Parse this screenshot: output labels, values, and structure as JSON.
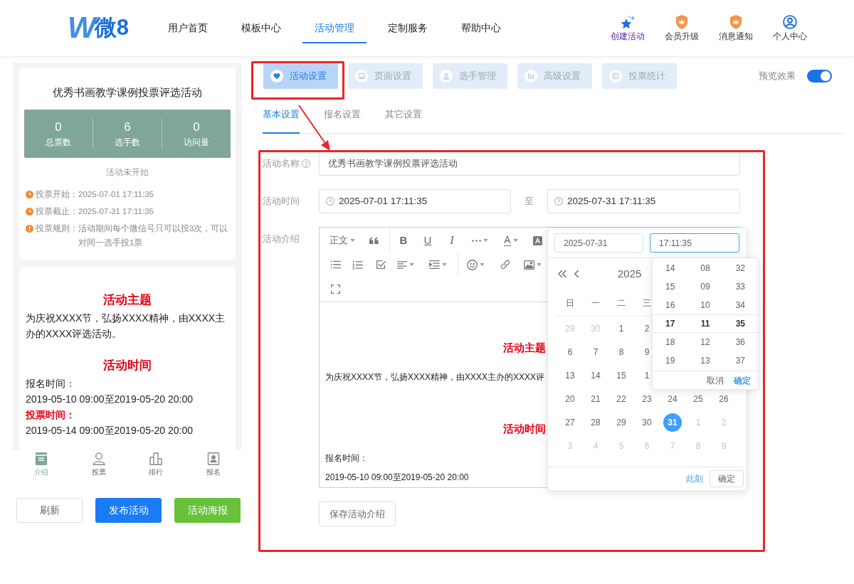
{
  "header": {
    "logo": {
      "mark": "W",
      "name": "微8"
    },
    "nav": [
      {
        "label": "用户首页",
        "selected": false
      },
      {
        "label": "模板中心",
        "selected": false
      },
      {
        "label": "活动管理",
        "selected": true
      },
      {
        "label": "定制服务",
        "selected": false
      },
      {
        "label": "帮助中心",
        "selected": false
      }
    ],
    "actions": [
      {
        "label": "创建活动",
        "highlighted": true
      },
      {
        "label": "会员升级",
        "highlighted": false
      },
      {
        "label": "消息通知",
        "highlighted": false
      },
      {
        "label": "个人中心",
        "highlighted": false
      }
    ]
  },
  "preview": {
    "title": "优秀书画教学课例投票评选活动",
    "stats": [
      {
        "value": "0",
        "label": "总票数"
      },
      {
        "value": "6",
        "label": "选手数"
      },
      {
        "value": "0",
        "label": "访问量"
      }
    ],
    "status": "活动未开始",
    "info": [
      {
        "kind": "time",
        "label": "投票开始：",
        "value": "2025-07-01 17:11:35"
      },
      {
        "kind": "time",
        "label": "投票截止：",
        "value": "2025-07-31 17:11:35"
      },
      {
        "kind": "rule",
        "label": "投票规则：",
        "value": "活动期间每个微信号只可以投3次，可以对同一选手投1票"
      }
    ],
    "article": [
      {
        "kind": "heading",
        "text": "活动主题"
      },
      {
        "kind": "paragraph",
        "text": "为庆祝XXXX节，弘扬XXXX精神，由XXXX主办的XXXX评选活动。"
      },
      {
        "kind": "heading",
        "text": "活动时间"
      },
      {
        "kind": "paragraph",
        "text": "报名时间："
      },
      {
        "kind": "paragraph",
        "text": "2019-05-10 09:00至2019-05-20 20:00"
      },
      {
        "kind": "label",
        "text": "投票时间："
      },
      {
        "kind": "paragraph",
        "text": "2019-05-14 09:00至2019-05-20 20:00"
      }
    ],
    "tabbar": [
      {
        "label": "介绍",
        "selected": true
      },
      {
        "label": "投票",
        "selected": false
      },
      {
        "label": "排行",
        "selected": false
      },
      {
        "label": "报名",
        "selected": false
      }
    ]
  },
  "preview_buttons": [
    {
      "label": "刷新",
      "kind": "default"
    },
    {
      "label": "发布活动",
      "kind": "primary"
    },
    {
      "label": "活动海报",
      "kind": "success"
    }
  ],
  "settings_tabs": [
    {
      "label": "活动设置",
      "selected": true
    },
    {
      "label": "页面设置",
      "selected": false
    },
    {
      "label": "选手管理",
      "selected": false
    },
    {
      "label": "高级设置",
      "selected": false
    },
    {
      "label": "投票统计",
      "selected": false
    }
  ],
  "preview_toggle": {
    "label": "预览效果",
    "on": true
  },
  "sub_tabs": [
    {
      "label": "基本设置",
      "selected": true
    },
    {
      "label": "报名设置",
      "selected": false
    },
    {
      "label": "其它设置",
      "selected": false
    }
  ],
  "form": {
    "name": {
      "label": "活动名称",
      "value": "优秀书画教学课例投票评选活动"
    },
    "time": {
      "label": "活动时间",
      "start": "2025-07-01 17:11:35",
      "separator": "至",
      "end": "2025-07-31 17:11:35"
    },
    "intro": {
      "label": "活动介绍",
      "toolbar": [
        [
          {
            "kind": "format",
            "text": "正文"
          },
          {
            "kind": "quote"
          },
          {
            "kind": "divider"
          },
          {
            "kind": "bold",
            "text": "B"
          },
          {
            "kind": "underline",
            "text": "U"
          },
          {
            "kind": "italic",
            "text": "I"
          },
          {
            "kind": "more"
          },
          {
            "kind": "font_color",
            "text": "A"
          },
          {
            "kind": "highlight"
          }
        ],
        [
          {
            "kind": "bullets"
          },
          {
            "kind": "numbers"
          },
          {
            "kind": "todo"
          },
          {
            "kind": "align"
          },
          {
            "kind": "indent"
          },
          {
            "kind": "divider"
          },
          {
            "kind": "emoji"
          },
          {
            "kind": "link"
          },
          {
            "kind": "image"
          }
        ],
        [
          {
            "kind": "fullscreen"
          }
        ]
      ],
      "content": [
        {
          "kind": "heading",
          "text": "活动主题"
        },
        {
          "kind": "paragraph",
          "text": "为庆祝XXXX节，弘扬XXXX精神，由XXXX主办的XXXX评"
        },
        {
          "kind": "heading",
          "text": "活动时间"
        },
        {
          "kind": "paragraph",
          "text": "报名时间："
        },
        {
          "kind": "paragraph",
          "text": "2019-05-10 09:00至2019-05-20 20:00"
        }
      ],
      "save": "保存活动介绍"
    }
  },
  "date_picker": {
    "date_input": {
      "value": "2025-07-31",
      "focused": false
    },
    "time_input": {
      "value": "17:11:35",
      "focused": true
    },
    "year": "2025",
    "weekdays": [
      "日",
      "一",
      "二",
      "三"
    ],
    "weeks": [
      [
        {
          "day": "29",
          "muted": true,
          "selected": false
        },
        {
          "day": "30",
          "muted": true,
          "selected": false
        },
        {
          "day": "1",
          "muted": false,
          "selected": false
        },
        {
          "day": "2",
          "muted": false,
          "selected": false
        }
      ],
      [
        {
          "day": "6",
          "muted": false,
          "selected": false
        },
        {
          "day": "7",
          "muted": false,
          "selected": false
        },
        {
          "day": "8",
          "muted": false,
          "selected": false
        },
        {
          "day": "9",
          "muted": false,
          "selected": false
        }
      ],
      [
        {
          "day": "13",
          "muted": false,
          "selected": false
        },
        {
          "day": "14",
          "muted": false,
          "selected": false
        },
        {
          "day": "15",
          "muted": false,
          "selected": false
        },
        {
          "day": "1",
          "muted": false,
          "selected": false
        }
      ],
      [
        {
          "day": "20",
          "muted": false,
          "selected": false
        },
        {
          "day": "21",
          "muted": false,
          "selected": false
        },
        {
          "day": "22",
          "muted": false,
          "selected": false
        },
        {
          "day": "23",
          "muted": false,
          "selected": false
        },
        {
          "day": "24",
          "muted": false,
          "selected": false
        },
        {
          "day": "25",
          "muted": false,
          "selected": false
        },
        {
          "day": "26",
          "muted": false,
          "selected": false
        }
      ],
      [
        {
          "day": "27",
          "muted": false,
          "selected": false
        },
        {
          "day": "28",
          "muted": false,
          "selected": false
        },
        {
          "day": "29",
          "muted": false,
          "selected": false
        },
        {
          "day": "30",
          "muted": false,
          "selected": false
        },
        {
          "day": "31",
          "muted": false,
          "selected": true
        },
        {
          "day": "1",
          "muted": true,
          "selected": false
        },
        {
          "day": "2",
          "muted": true,
          "selected": false
        }
      ],
      [
        {
          "day": "3",
          "muted": true,
          "selected": false
        },
        {
          "day": "4",
          "muted": true,
          "selected": false
        },
        {
          "day": "5",
          "muted": true,
          "selected": false
        },
        {
          "day": "6",
          "muted": true,
          "selected": false
        },
        {
          "day": "7",
          "muted": true,
          "selected": false
        },
        {
          "day": "8",
          "muted": true,
          "selected": false
        },
        {
          "day": "9",
          "muted": true,
          "selected": false
        }
      ]
    ],
    "now": "此刻",
    "confirm": "确定",
    "time_panel": {
      "columns": [
        [
          {
            "text": "14",
            "selected": false
          },
          {
            "text": "15",
            "selected": false
          },
          {
            "text": "16",
            "selected": false
          },
          {
            "text": "17",
            "selected": true
          },
          {
            "text": "18",
            "selected": false
          },
          {
            "text": "19",
            "selected": false
          }
        ],
        [
          {
            "text": "08",
            "selected": false
          },
          {
            "text": "09",
            "selected": false
          },
          {
            "text": "10",
            "selected": false
          },
          {
            "text": "11",
            "selected": true
          },
          {
            "text": "12",
            "selected": false
          },
          {
            "text": "13",
            "selected": false
          }
        ],
        [
          {
            "text": "32",
            "selected": false
          },
          {
            "text": "33",
            "selected": false
          },
          {
            "text": "34",
            "selected": false
          },
          {
            "text": "35",
            "selected": true
          },
          {
            "text": "36",
            "selected": false
          },
          {
            "text": "37",
            "selected": false
          }
        ]
      ],
      "cancel": "取消",
      "confirm": "确定"
    }
  }
}
